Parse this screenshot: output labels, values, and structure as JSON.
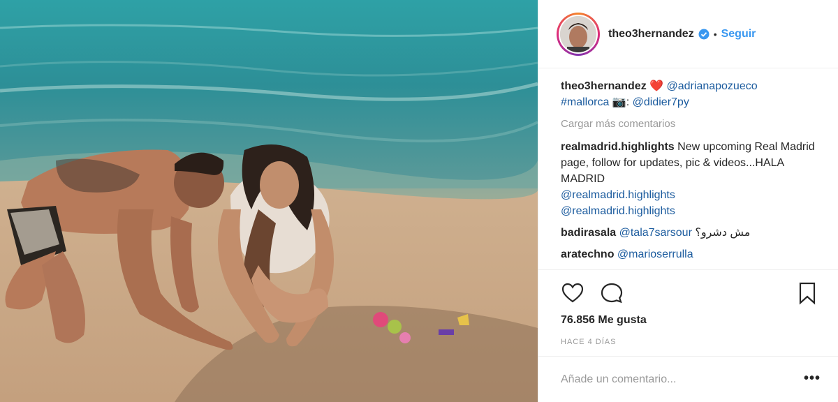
{
  "post": {
    "author": "theo3hernandez",
    "follow_label": "Seguir",
    "separator": "•",
    "caption": {
      "user": "theo3hernandez",
      "heart": "❤️",
      "mention1": "@adrianapozueco",
      "hashtag": "#mallorca",
      "camera": "📷:",
      "mention2": "@didier7py"
    },
    "load_more": "Cargar más comentarios",
    "comments": [
      {
        "user": "realmadrid.highlights",
        "text": "New upcoming Real Madrid page, follow for updates, pic & videos...HALA MADRID",
        "mentions": [
          "@realmadrid.highlights",
          "@realmadrid.highlights"
        ]
      },
      {
        "user": "badirasala",
        "mention": "@tala7sarsour",
        "text": "مش دشرو؟"
      },
      {
        "user": "aratechno",
        "mention": "@marioserrulla"
      }
    ],
    "likes": "76.856 Me gusta",
    "time": "HACE 4 DÍAS",
    "add_comment_placeholder": "Añade un comentario...",
    "more_label": "•••"
  },
  "icons": {
    "like": "heart-outline-icon",
    "comment": "speech-bubble-icon",
    "save": "bookmark-icon",
    "verified": "verified-badge-icon"
  },
  "colors": {
    "link": "#3897f0",
    "mention": "#1b5b9e",
    "muted": "#999999",
    "text": "#262626"
  }
}
